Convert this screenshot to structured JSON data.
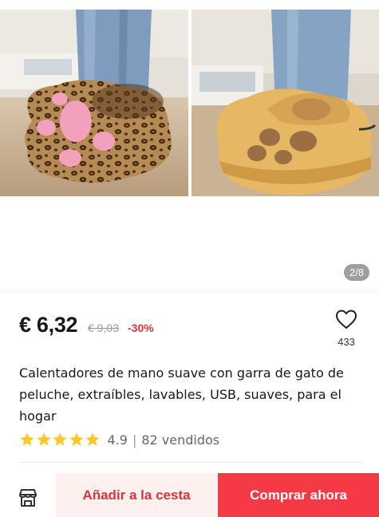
{
  "gallery": {
    "images": [
      {
        "icon": "leopard-paw-slipper-photo"
      },
      {
        "icon": "yellow-paw-slipper-photo"
      }
    ],
    "page_indicator": "2/8"
  },
  "price": {
    "current": "€ 6,32",
    "original": "€ 9,03",
    "discount": "-30%"
  },
  "wishlist": {
    "icon": "heart-outline-icon",
    "count": "433"
  },
  "product": {
    "title": "Calentadores de mano suave con garra de gato de peluche, extraíbles, lavables, USB, suaves, para el hogar"
  },
  "rating": {
    "stars": 5,
    "value": "4.9",
    "separator": "|",
    "sold": "82 vendidos",
    "star_color": "#ffc82a"
  },
  "actions": {
    "store_icon": "store-icon",
    "add_to_cart": "Añadir a la cesta",
    "buy_now": "Comprar ahora"
  },
  "colors": {
    "accent": "#f53a45",
    "accent_text": "#e0323a",
    "cart_bg": "#fff0f0"
  }
}
